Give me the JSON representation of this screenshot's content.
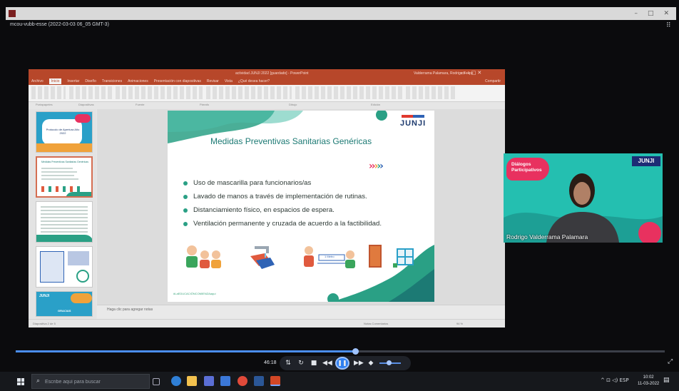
{
  "window": {
    "title": "mcou-vubb-esse (2022-03-03 06_05 GMT-3)",
    "controls": [
      "–",
      "□",
      "✕"
    ],
    "more": "⠿"
  },
  "powerpoint": {
    "title": "actividad JUNJI 2022 [guardado] - PowerPoint",
    "user": "Valderrama Palamara, Rodrigo Felipe",
    "share_label": "Compartir",
    "window_controls": "▭  –  □  ✕",
    "tabs": [
      "Archivo",
      "Inicio",
      "Insertar",
      "Diseño",
      "Transiciones",
      "Animaciones",
      "Presentación con diapositivas",
      "Revisar",
      "Vista",
      "¿Qué desea hacer?"
    ],
    "active_tab": "Inicio",
    "ribbon_groups": [
      "Portapapeles",
      "Diapositivas",
      "Fuente",
      "Párrafo",
      "Dibujo",
      "Edición"
    ],
    "notes_placeholder": "Haga clic para agregar notas",
    "status_left": "Diapositiva 2 de 5",
    "status_right": "Notas   Comentarios",
    "zoom": "94 %"
  },
  "thumbnails": [
    {
      "num": "1",
      "title": "Protocolo de Apertura Año 2022"
    },
    {
      "num": "2",
      "title": "Medidas Preventivas Sanitarias Genéricas"
    },
    {
      "num": "3",
      "title": ""
    },
    {
      "num": "4",
      "title": ""
    },
    {
      "num": "5",
      "title": "GRACIAS"
    }
  ],
  "slide": {
    "logo": "JUNJI",
    "title": "Medidas Preventivas Sanitarias Genéricas",
    "bullets": [
      "Uso de mascarilla para funcionarios/as",
      "Lavado de manos a través de implementación de rutinas.",
      "Distanciamiento físico, en espacios de espera.",
      "Ventilación permanente y cruzada de acuerdo a la factibilidad."
    ],
    "distance_sign": "1 Metro",
    "hashtag": "#LaEDUCACIÓNCOMIENZAaquí",
    "chevron_colors": [
      "#e8315f",
      "#e8315f",
      "#f0a23a",
      "#2aa085",
      "#2f63b5"
    ]
  },
  "webcam": {
    "badge_line1": "Diálogos",
    "badge_line2": "Participativos",
    "logo": "JUNJI",
    "name": "Rodrigo Valderrama Palamara"
  },
  "player": {
    "time": "46:18",
    "progress": 0.523,
    "buttons": [
      "⇅",
      "↻",
      "■",
      "◀◀",
      "❚❚",
      "▶▶",
      "◆"
    ],
    "expand": "⤢"
  },
  "taskbar": {
    "search_placeholder": "Escribe aquí para buscar",
    "tray": "^  ⊡  ◁)  ESP",
    "time": "10:02",
    "date": "11-03-2022",
    "notifications": "▤"
  }
}
